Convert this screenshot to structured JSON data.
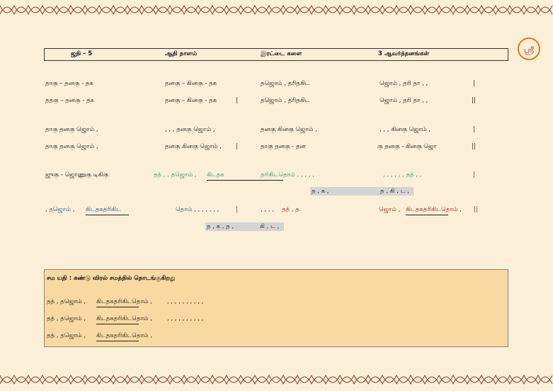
{
  "header": {
    "jathi": "ஜதி – 5",
    "talam": "ஆதி தாளம்",
    "kalai": "இரட்டை களை",
    "avarthanam": "3  ஆவர்த்தனங்கள்"
  },
  "block1": {
    "row1": [
      "தாகு – தனகு - தக",
      "தனகு – கினகு - தக",
      "தஜொம் , தரிதகிட",
      "ஜொம் ,  தரி   தா , ,",
      "|"
    ],
    "row2": [
      "ததகு – தனகு - தக",
      "தனகு – கினகு - தக",
      "|",
      "தஜொம் , தரிதகிட",
      "ஜொம் ,  தரி   தா , ,",
      "||"
    ]
  },
  "block2": {
    "row1": [
      "தாகு தனகு ஜொம் ,",
      ", , ,    தனகு ஜொம் ,",
      "தனகு கினகு ஜொம் ,",
      ", , ,  கினகு ஜொம் ,",
      "|"
    ],
    "row2": [
      "தாகு தனகு ஜொம் ,",
      "தனகு கினகு ஜொம் ,",
      "|",
      "தாகு தனகு  -  தன",
      "கு தனகு -   கினகு ஜொ",
      "||"
    ]
  },
  "block3": {
    "row1": {
      "a": "ஜுகு - ஜொணுகு டிகிகு",
      "b": "தத் , , தஜொம் ,",
      "c": "கிடதக",
      "d": "தரிகிடதொம் ,  , , , ,",
      "e": ", , , ,  , ,  தத் , ,",
      "bar": "|"
    },
    "row1_sub": {
      "a": "த ,  க ,",
      "b": "த ,  கி ,  ட ,"
    },
    "row2": {
      "a": ", தஜொம் ,",
      "b": "கிடதகதரிகிட",
      "c": "தொம் ,  , ,  , ,  , ,",
      "bar1": "|",
      "d": ", ,   , ,",
      "e": "தத் ,  த",
      "f": "ஜொம் ,",
      "g": "கிடதகதரிகிடதொம் ,",
      "bar2": "||"
    },
    "row2_sub": {
      "a": "த ,  க ,   த ,",
      "b": "கி ,   ட ,"
    }
  },
  "sama": {
    "title": "சம யதி : சுண்டு விரல் சமத்தில் தொடங்குகிறது",
    "lines": [
      {
        "a": "தத் ,  தஜொம் ,",
        "b": "கிடதகதரிகிடதொம் ,",
        "c": ", ,  , ,  , , , , , ,"
      },
      {
        "a": "தத் ,  தஜொம் ,",
        "b": "கிடதகதரிகிடதொம் ,",
        "c": ", ,  , ,  , , , , , ,"
      },
      {
        "a": "தத் ,  தஜொம் ,",
        "b": "கிடதகதரிகிடதொம் ,"
      }
    ]
  },
  "logo": {
    "glyph": "ஸ்ரீ"
  },
  "colors": {
    "background": "#fbefd7",
    "border": "#9c4a3a",
    "green": "#1e9e6a",
    "red": "#a8201a",
    "box": "#f9d9a2"
  }
}
